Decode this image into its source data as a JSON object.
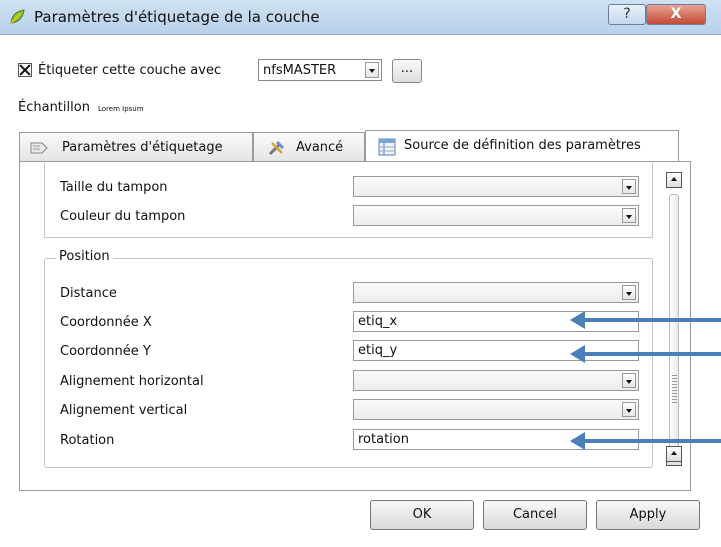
{
  "window": {
    "title": "Paramètres d'étiquetage de la couche",
    "help_label": "?",
    "close_label": "X"
  },
  "label_layer": {
    "checked": true,
    "label": "Étiqueter cette couche avec",
    "field_value": "nfsMASTER",
    "more_label": "..."
  },
  "sample": {
    "label": "Échantillon",
    "text": "Lorem Ipsum"
  },
  "tabs": [
    {
      "label": "Paramètres d'étiquetage",
      "icon": "label-icon",
      "active": false
    },
    {
      "label": "Avancé",
      "icon": "tools-icon",
      "active": false
    },
    {
      "label": "Source de définition des paramètres",
      "icon": "table-icon",
      "active": true
    }
  ],
  "buffer_section": {
    "rows": [
      {
        "label": "Taille du tampon",
        "value": ""
      },
      {
        "label": "Couleur du tampon",
        "value": ""
      }
    ]
  },
  "position_section": {
    "title": "Position",
    "rows": [
      {
        "label": "Distance",
        "value": ""
      },
      {
        "label": "Coordonnée X",
        "value": "etiq_x"
      },
      {
        "label": "Coordonnée Y",
        "value": "etiq_y"
      },
      {
        "label": "Alignement horizontal",
        "value": ""
      },
      {
        "label": "Alignement vertical",
        "value": ""
      },
      {
        "label": "Rotation",
        "value": "rotation"
      }
    ]
  },
  "buttons": {
    "ok": "OK",
    "cancel": "Cancel",
    "apply": "Apply"
  },
  "colors": {
    "annotation_arrow": "#4b7fbb",
    "title_bar": "#c4daf0",
    "close_button": "#c24a36"
  }
}
